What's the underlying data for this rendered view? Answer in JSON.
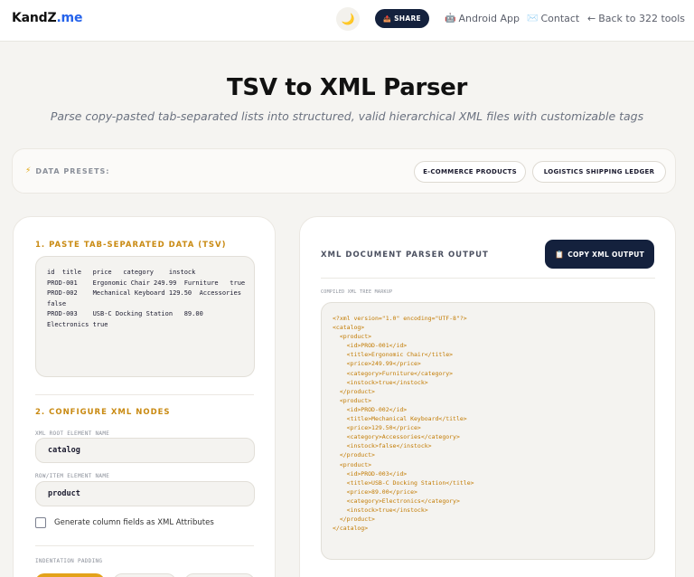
{
  "header": {
    "brand_main": "KandZ",
    "brand_suffix": ".me",
    "theme_icon": "🌙",
    "share_icon": "📤",
    "share_label": "SHARE",
    "android_icon": "🤖",
    "android_label": "Android App",
    "contact_icon": "✉️",
    "contact_label": "Contact",
    "back_icon": "←",
    "back_label": "Back to 322 tools"
  },
  "hero": {
    "title": "TSV to XML Parser",
    "subtitle": "Parse copy-pasted tab-separated lists into structured, valid hierarchical XML files with customizable tags"
  },
  "presets": {
    "icon": "⚡",
    "label": "DATA PRESETS:",
    "buttons": [
      "E-COMMERCE PRODUCTS",
      "LOGISTICS SHIPPING LEDGER"
    ]
  },
  "input_panel": {
    "step1_title": "1. PASTE TAB-SEPARATED DATA (TSV)",
    "tsv_text": "id  title   price   category    instock\nPROD-001    Ergonomic Chair 249.99  Furniture   true\nPROD-002    Mechanical Keyboard 129.50  Accessories\nfalse\nPROD-003    USB-C Docking Station   89.00\nElectronics true",
    "step2_title": "2. CONFIGURE XML NODES",
    "root_label": "XML ROOT ELEMENT NAME",
    "root_value": "catalog",
    "row_label": "ROW/ITEM ELEMENT NAME",
    "row_value": "product",
    "attributes_checkbox_label": "Generate column fields as XML Attributes",
    "attributes_checked": false,
    "indentation_label": "INDENTATION PADDING"
  },
  "output_panel": {
    "title": "XML DOCUMENT PARSER OUTPUT",
    "copy_icon": "📋",
    "copy_label": "COPY XML OUTPUT",
    "caption": "COMPILED XML TREE MARKUP",
    "xml_text": "<?xml version=\"1.0\" encoding=\"UTF-8\"?>\n<catalog>\n  <product>\n    <id>PROD-001</id>\n    <title>Ergonomic Chair</title>\n    <price>249.99</price>\n    <category>Furniture</category>\n    <instock>true</instock>\n  </product>\n  <product>\n    <id>PROD-002</id>\n    <title>Mechanical Keyboard</title>\n    <price>129.50</price>\n    <category>Accessories</category>\n    <instock>false</instock>\n  </product>\n  <product>\n    <id>PROD-003</id>\n    <title>USB-C Docking Station</title>\n    <price>89.00</price>\n    <category>Electronics</category>\n    <instock>true</instock>\n  </product>\n</catalog>"
  },
  "colors": {
    "accent_gold": "#c98a12",
    "navy": "#14213d",
    "brand_blue": "#2563eb",
    "xml_text": "#c27a00"
  }
}
